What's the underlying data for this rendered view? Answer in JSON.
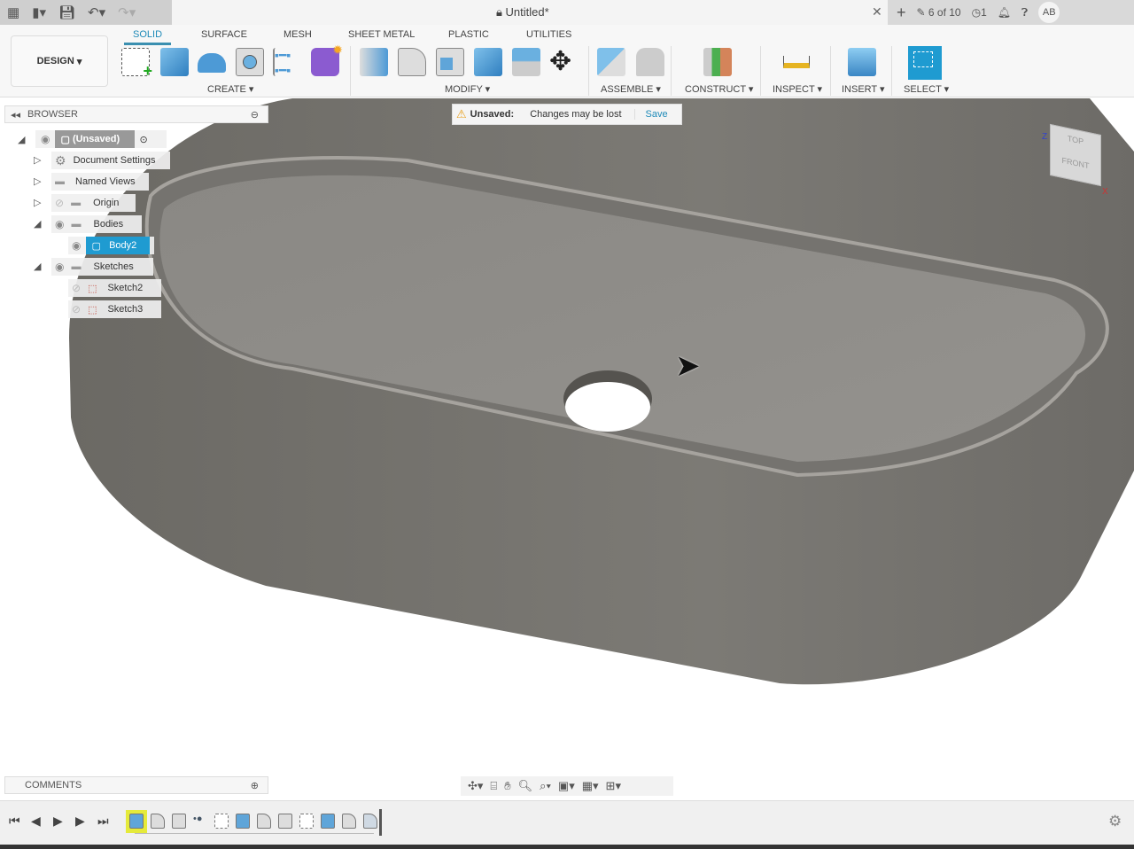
{
  "titlebar": {
    "doc_title": "Untitled*",
    "version": "6 of 10",
    "jobs": "1",
    "user_initials": "AB"
  },
  "ribbon": {
    "workspace": "DESIGN",
    "tabs": [
      "SOLID",
      "SURFACE",
      "MESH",
      "SHEET METAL",
      "PLASTIC",
      "UTILITIES"
    ],
    "active_tab": "SOLID",
    "groups": [
      "CREATE",
      "MODIFY",
      "ASSEMBLE",
      "CONSTRUCT",
      "INSPECT",
      "INSERT",
      "SELECT"
    ]
  },
  "browser": {
    "title": "BROWSER",
    "nodes": [
      {
        "label": "(Unsaved)"
      },
      {
        "label": "Document Settings"
      },
      {
        "label": "Named Views"
      },
      {
        "label": "Origin"
      },
      {
        "label": "Bodies"
      },
      {
        "label": "Body2",
        "selected": true
      },
      {
        "label": "Sketches"
      },
      {
        "label": "Sketch2"
      },
      {
        "label": "Sketch3"
      }
    ]
  },
  "banner": {
    "label": "Unsaved:",
    "message": "Changes may be lost",
    "action": "Save"
  },
  "viewcube": {
    "top": "TOP",
    "front": "FRONT",
    "axis_z": "Z",
    "axis_x": "X"
  },
  "comments": {
    "title": "COMMENTS"
  },
  "colors": {
    "accent": "#1e8ab8",
    "selected": "#1f9bd1",
    "body": "#76746f",
    "floor": "#8e8c88"
  }
}
